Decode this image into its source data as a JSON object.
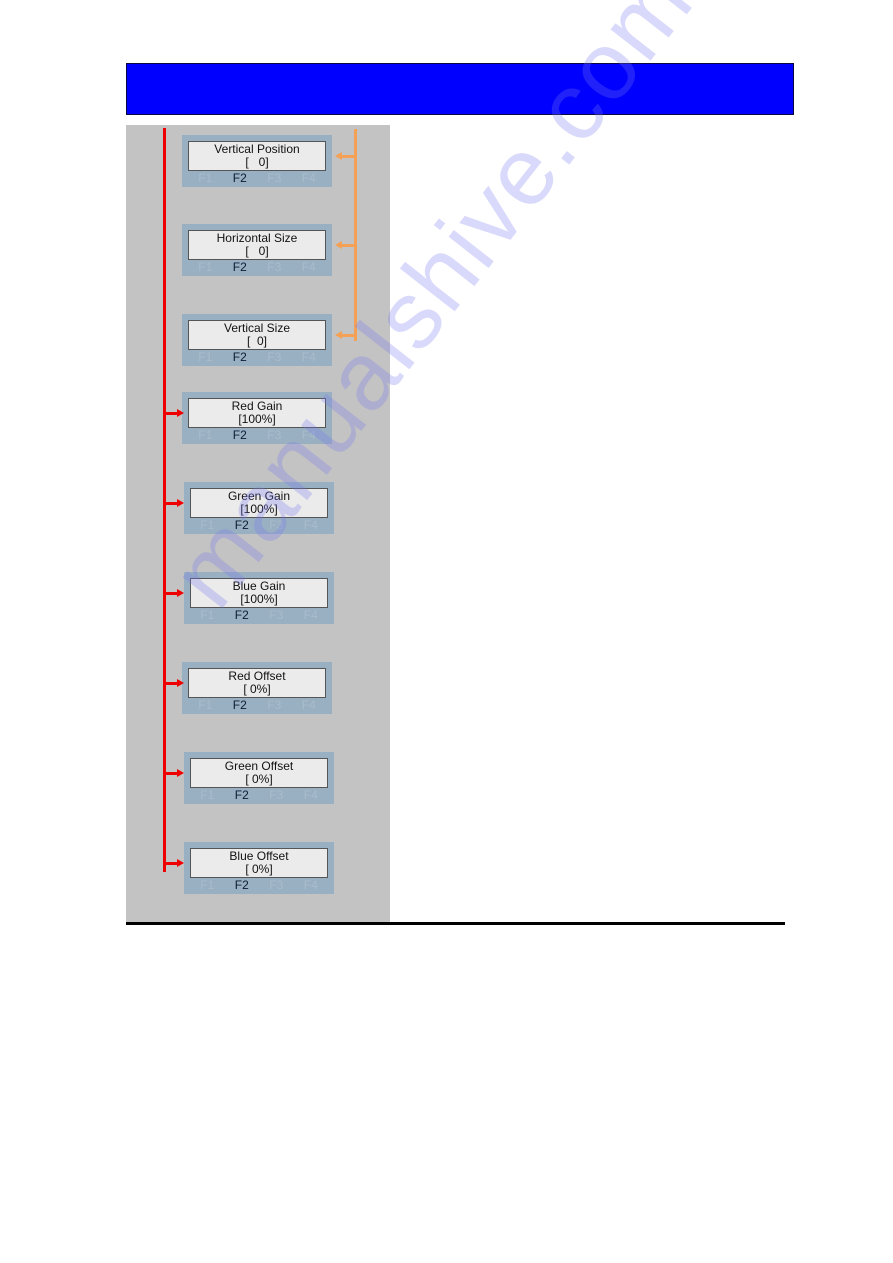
{
  "header": {
    "title": "",
    "color": "#0000fe"
  },
  "diagram": {
    "panel_color": "#c3c3c3",
    "connector_colors": {
      "main_tree": "#ef0000",
      "sub_group": "#f4a055"
    },
    "osd_boxes": [
      {
        "title": "Vertical Position",
        "value": "[   0]",
        "keys": [
          "F1",
          "F2",
          "F3",
          "F4"
        ],
        "active_key": "F2",
        "group": "orange"
      },
      {
        "title": "Horizontal Size",
        "value": "[   0]",
        "keys": [
          "F1",
          "F2",
          "F3",
          "F4"
        ],
        "active_key": "F2",
        "group": "orange"
      },
      {
        "title": "Vertical Size",
        "value": "[  0]",
        "keys": [
          "F1",
          "F2",
          "F3",
          "F4"
        ],
        "active_key": "F2",
        "group": "orange"
      },
      {
        "title": "Red Gain",
        "value": "[100%]",
        "keys": [
          "F1",
          "F2",
          "F3",
          "F4"
        ],
        "active_key": "F2",
        "group": "red"
      },
      {
        "title": "Green Gain",
        "value": "[100%]",
        "keys": [
          "F1",
          "F2",
          "F3",
          "F4"
        ],
        "active_key": "F2",
        "group": "red"
      },
      {
        "title": "Blue Gain",
        "value": "[100%]",
        "keys": [
          "F1",
          "F2",
          "F3",
          "F4"
        ],
        "active_key": "F2",
        "group": "red"
      },
      {
        "title": "Red Offset",
        "value": "[ 0%]",
        "keys": [
          "F1",
          "F2",
          "F3",
          "F4"
        ],
        "active_key": "F2",
        "group": "red"
      },
      {
        "title": "Green Offset",
        "value": "[ 0%]",
        "keys": [
          "F1",
          "F2",
          "F3",
          "F4"
        ],
        "active_key": "F2",
        "group": "red"
      },
      {
        "title": "Blue Offset",
        "value": "[ 0%]",
        "keys": [
          "F1",
          "F2",
          "F3",
          "F4"
        ],
        "active_key": "F2",
        "group": "red"
      }
    ]
  },
  "watermark": "manualshive.com"
}
